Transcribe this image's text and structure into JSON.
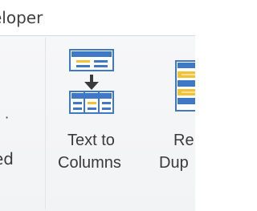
{
  "tab": {
    "label": "eloper"
  },
  "left_group": {
    "label": "ed",
    "glyph": "·"
  },
  "buttons": {
    "text_to_columns": {
      "line1": "Text to",
      "line2": "Columns",
      "icon": "text-to-columns-icon"
    },
    "remove_duplicates": {
      "line1": "Re",
      "line2": "Dup",
      "icon": "remove-duplicates-icon"
    }
  },
  "colors": {
    "icon_blue": "#3f78c4",
    "icon_yellow": "#f1c232",
    "icon_white": "#ffffff",
    "arrow": "#3b3b3b"
  }
}
